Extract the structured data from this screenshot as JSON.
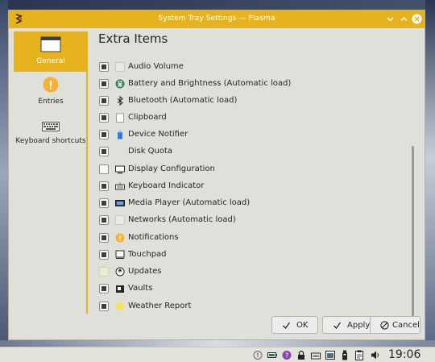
{
  "window": {
    "title": "System Tray Settings — Plasma"
  },
  "sidebar": {
    "items": [
      {
        "label": "General",
        "icon": "window-icon",
        "active": true
      },
      {
        "label": "Entries",
        "icon": "info-icon",
        "active": false
      },
      {
        "label": "Keyboard shortcuts",
        "icon": "keyboard-icon",
        "active": false
      }
    ]
  },
  "main": {
    "heading": "Extra Items",
    "items": [
      {
        "label": "Audio Volume",
        "checked": true,
        "icon": "audio-icon"
      },
      {
        "label": "Battery and Brightness (Automatic load)",
        "checked": true,
        "icon": "battery-icon"
      },
      {
        "label": "Bluetooth (Automatic load)",
        "checked": true,
        "icon": "bluetooth-icon"
      },
      {
        "label": "Clipboard",
        "checked": true,
        "icon": "clipboard-icon"
      },
      {
        "label": "Device Notifier",
        "checked": true,
        "icon": "device-icon"
      },
      {
        "label": "Disk Quota",
        "checked": true,
        "icon": "disk-quota-icon"
      },
      {
        "label": "Display Configuration",
        "checked": false,
        "icon": "display-icon"
      },
      {
        "label": "Keyboard Indicator",
        "checked": true,
        "icon": "keyboard-indicator-icon"
      },
      {
        "label": "Media Player (Automatic load)",
        "checked": true,
        "icon": "media-player-icon"
      },
      {
        "label": "Networks (Automatic load)",
        "checked": true,
        "icon": "network-icon"
      },
      {
        "label": "Notifications",
        "checked": true,
        "icon": "notifications-icon"
      },
      {
        "label": "Touchpad",
        "checked": true,
        "icon": "touchpad-icon"
      },
      {
        "label": "Updates",
        "checked": false,
        "icon": "updates-icon"
      },
      {
        "label": "Vaults",
        "checked": true,
        "icon": "vaults-icon"
      },
      {
        "label": "Weather Report",
        "checked": true,
        "icon": "weather-icon"
      }
    ]
  },
  "buttons": {
    "ok": "OK",
    "apply": "Apply",
    "cancel": "Cancel"
  },
  "panel": {
    "clock": "19:06",
    "tray_icons": [
      "notification-icon",
      "battery-icon",
      "help-icon",
      "lock-icon",
      "keyboard-icon",
      "files-icon",
      "usb-icon",
      "clipboard-icon",
      "audio-icon"
    ]
  },
  "colors": {
    "accent": "#e6b31e",
    "window_bg": "#dfe0d9",
    "checkbox_fill": "#3b3f42",
    "panel_bg": "#e3e3dc"
  }
}
